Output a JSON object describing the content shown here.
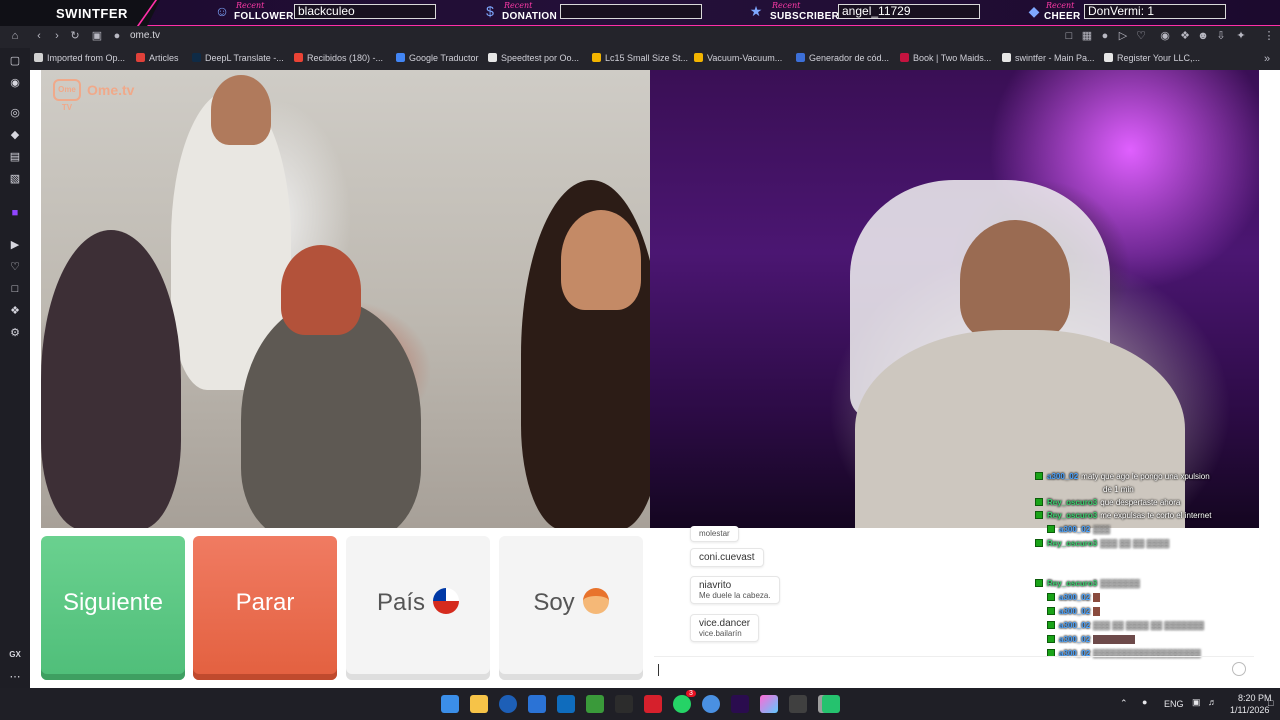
{
  "overlay": {
    "brand": "SWINTFER",
    "recent_label": "Recent",
    "follower": {
      "kind": "FOLLOWER",
      "value": "blackculeo",
      "icon": "person-icon"
    },
    "donation": {
      "kind": "DONATION",
      "value": "",
      "icon": "dollar-icon"
    },
    "subscriber": {
      "kind": "SUBSCRIBER",
      "value": "angel_11729",
      "icon": "star-icon"
    },
    "cheer": {
      "kind": "CHEER",
      "value": "DonVermi: 1",
      "icon": "diamond-icon"
    }
  },
  "browser": {
    "url": "ome.tv",
    "bookmarks": [
      {
        "label": "Imported from Op...",
        "color": "#d2d2d2"
      },
      {
        "label": "Articles",
        "color": "#e0413a"
      },
      {
        "label": "DeepL Translate -...",
        "color": "#0f2b46"
      },
      {
        "label": "Recibidos (180) -...",
        "color": "#ea4335"
      },
      {
        "label": "Google Traductor",
        "color": "#4285f4"
      },
      {
        "label": "Speedtest por Oo...",
        "color": "#e6e6e6"
      },
      {
        "label": "Lc15 Small Size St...",
        "color": "#f2b400"
      },
      {
        "label": "Vacuum-Vacuum...",
        "color": "#f2b400"
      },
      {
        "label": "Generador de cód...",
        "color": "#3c6fd8"
      },
      {
        "label": "Book | Two Maids...",
        "color": "#c3133f"
      },
      {
        "label": "swintfer - Main Pa...",
        "color": "#e6e6e6"
      },
      {
        "label": "Register Your LLC,...",
        "color": "#e6e6e6"
      }
    ],
    "sidebar_label": "GX"
  },
  "ometv": {
    "badge": "Ome TV",
    "logo": "Ome.tv",
    "buttons": {
      "next": "Siguiente",
      "stop": "Parar",
      "country": "País",
      "gender": "Soy"
    },
    "chat": [
      {
        "name": "molestar",
        "text": ""
      },
      {
        "name": "coni.cuevast",
        "text": ""
      },
      {
        "name": "niavrito",
        "text": "Me duele la cabeza."
      },
      {
        "name": "vice.dancer",
        "text": "vice.bailarín"
      }
    ]
  },
  "stream_chat": [
    {
      "user": "a300_02",
      "text": "maty que ago le pongo una xpulsion",
      "color": "#4aa3ff"
    },
    {
      "user": "",
      "text": "de 1 min",
      "color": "#4aa3ff"
    },
    {
      "user": "Rey_oscuro3",
      "text": "que despertaste ahora",
      "color": "#3bd16f"
    },
    {
      "user": "Rey_oscuro3",
      "text": "me expulsas te corto el internet",
      "color": "#3bd16f"
    },
    {
      "user": "a300_02",
      "text": "",
      "color": "#4aa3ff"
    },
    {
      "user": "Rey_oscuro3",
      "text": "",
      "color": "#3bd16f"
    },
    {
      "user": "Rey_oscuro3",
      "text": "",
      "color": "#3bd16f"
    },
    {
      "user": "a300_02",
      "text": "",
      "color": "#4aa3ff"
    },
    {
      "user": "a300_02",
      "text": "",
      "color": "#4aa3ff"
    },
    {
      "user": "a300_02",
      "text": "",
      "color": "#4aa3ff"
    },
    {
      "user": "a300_02",
      "text": "",
      "color": "#4aa3ff"
    },
    {
      "user": "a300_02",
      "text": "",
      "color": "#4aa3ff"
    }
  ],
  "taskbar": {
    "language": "ENG",
    "time": "8:20 PM",
    "date": "1/11/2026",
    "notification_badge": "3"
  }
}
